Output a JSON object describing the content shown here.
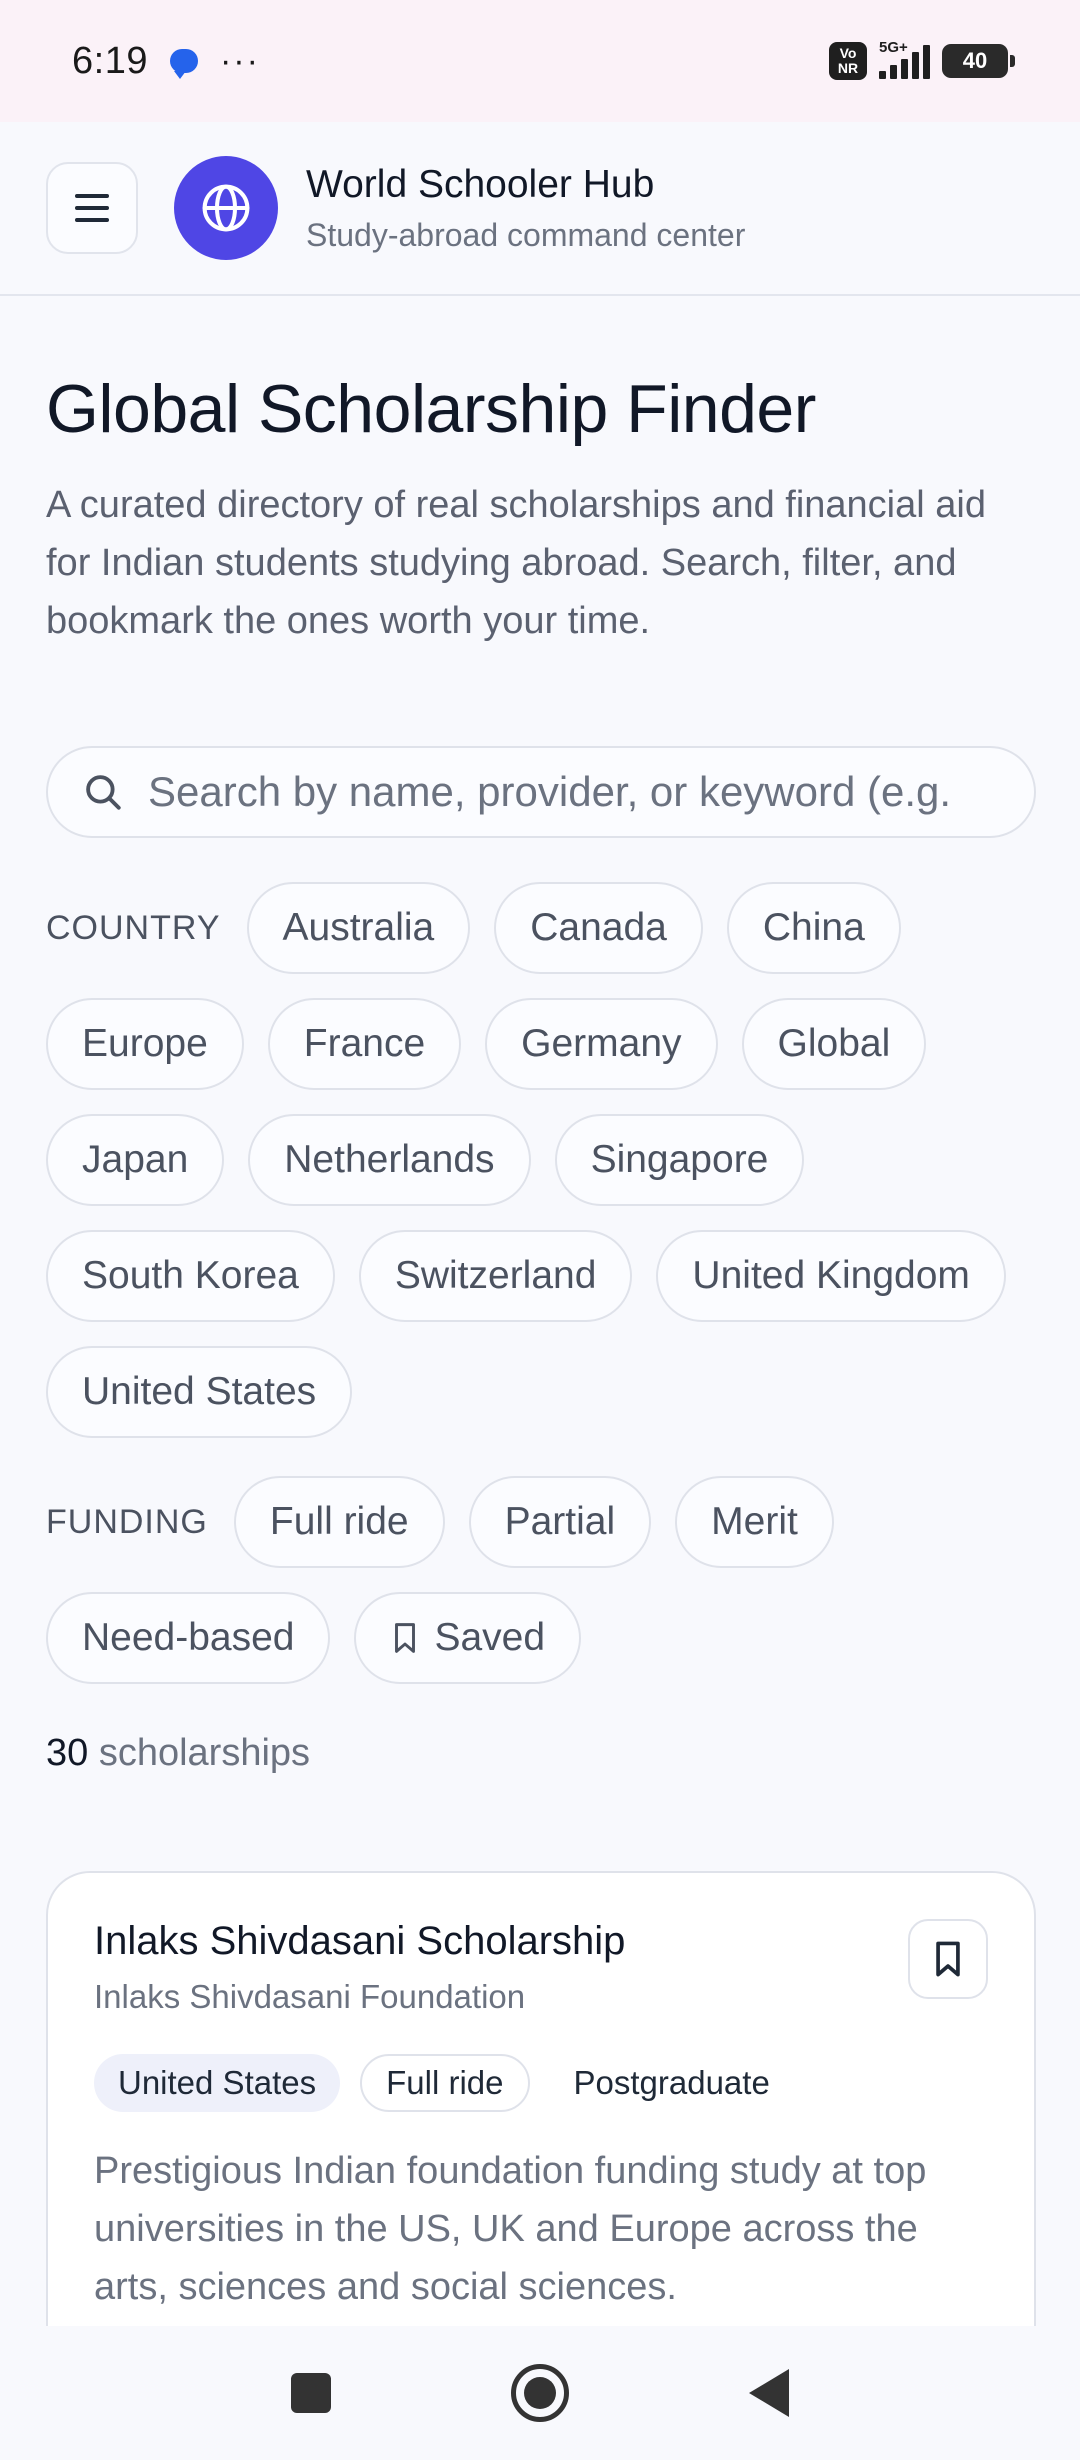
{
  "status_bar": {
    "time": "6:19",
    "dots": "···",
    "volte_top": "Vo",
    "volte_bottom": "NR",
    "network": "5G+",
    "battery": "40"
  },
  "header": {
    "brand_title": "World Schooler Hub",
    "brand_subtitle": "Study-abroad command center",
    "icons": {
      "menu": "hamburger-menu-icon",
      "logo": "globe-icon"
    },
    "accent": "#4f46e5"
  },
  "page": {
    "title": "Global Scholarship Finder",
    "description": "A curated directory of real scholarships and financial aid for Indian students studying abroad. Search, filter, and bookmark the ones worth your time."
  },
  "search": {
    "placeholder": "Search by name, provider, or keyword (e.g. ",
    "value": ""
  },
  "filters": {
    "country_label": "COUNTRY",
    "countries": [
      "Australia",
      "Canada",
      "China",
      "Europe",
      "France",
      "Germany",
      "Global",
      "Japan",
      "Netherlands",
      "Singapore",
      "South Korea",
      "Switzerland",
      "United Kingdom",
      "United States"
    ],
    "funding_label": "FUNDING",
    "funding": [
      "Full ride",
      "Partial",
      "Merit",
      "Need-based"
    ],
    "saved_label": "Saved"
  },
  "results": {
    "count": "30",
    "count_label": " scholarships"
  },
  "cards": [
    {
      "title": "Inlaks Shivdasani Scholarship",
      "provider": "Inlaks Shivdasani Foundation",
      "country": "United States",
      "funding": "Full ride",
      "level": "Postgraduate",
      "description": "Prestigious Indian foundation funding study at top universities in the US, UK and Europe across the arts, sciences and social sciences."
    }
  ]
}
